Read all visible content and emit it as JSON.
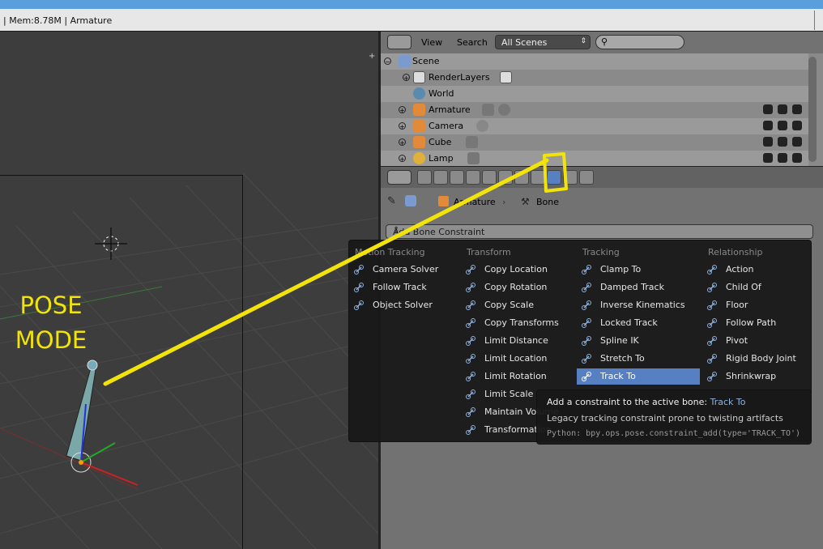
{
  "infobar": {
    "text": "| Mem:8.78M | Armature"
  },
  "viewport": {
    "overlay_text_line1": "POSE",
    "overlay_text_line2": "MODE"
  },
  "outliner": {
    "menu_view": "View",
    "menu_search": "Search",
    "scene_dropdown": "All Scenes",
    "search_placeholder": "",
    "rows": [
      {
        "label": "Scene"
      },
      {
        "label": "RenderLayers"
      },
      {
        "label": "World"
      },
      {
        "label": "Armature"
      },
      {
        "label": "Camera"
      },
      {
        "label": "Cube"
      },
      {
        "label": "Lamp"
      }
    ]
  },
  "properties": {
    "breadcrumb_armature": "Armature",
    "breadcrumb_bone": "Bone",
    "add_constraint_label": "Add Bone Constraint"
  },
  "menu": {
    "columns": [
      {
        "heading": "Motion Tracking",
        "items": [
          "Camera Solver",
          "Follow Track",
          "Object Solver"
        ]
      },
      {
        "heading": "Transform",
        "items": [
          "Copy Location",
          "Copy Rotation",
          "Copy Scale",
          "Copy Transforms",
          "Limit Distance",
          "Limit Location",
          "Limit Rotation",
          "Limit Scale",
          "Maintain Volume",
          "Transformation"
        ]
      },
      {
        "heading": "Tracking",
        "items": [
          "Clamp To",
          "Damped Track",
          "Inverse Kinematics",
          "Locked Track",
          "Spline IK",
          "Stretch To",
          "Track To"
        ]
      },
      {
        "heading": "Relationship",
        "items": [
          "Action",
          "Child Of",
          "Floor",
          "Follow Path",
          "Pivot",
          "Rigid Body Joint",
          "Shrinkwrap"
        ]
      }
    ],
    "highlighted": "Track To"
  },
  "tooltip": {
    "line1_prefix": "Add a constraint to the active bone:",
    "line1_value": "Track To",
    "line2": "Legacy tracking constraint prone to twisting artifacts",
    "line3": "Python: bpy.ops.pose.constraint_add(type='TRACK_TO')"
  },
  "colors": {
    "annotation": "#f2e40a",
    "highlight": "#5680c2",
    "title_bar": "#5a9fdd"
  }
}
